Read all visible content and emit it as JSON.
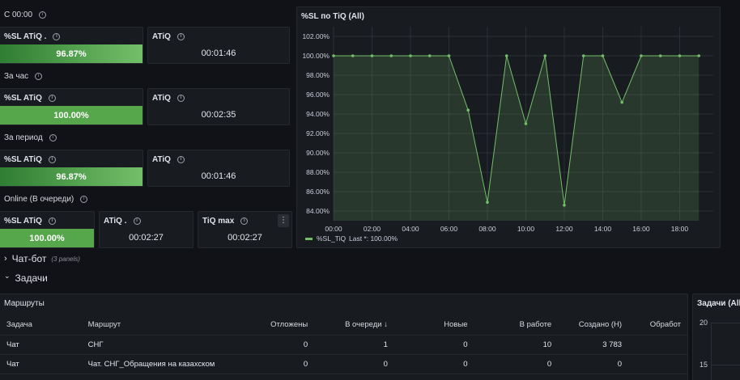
{
  "rows": {
    "c0000": "С 00:00",
    "hour": "За час",
    "period": "За период",
    "online": "Online (В очереди)"
  },
  "panels": {
    "c_sl": {
      "title": "%SL ATiQ .",
      "value": "96.87%"
    },
    "c_atiq": {
      "title": "ATiQ",
      "value": "00:01:46"
    },
    "h_sl": {
      "title": "%SL ATiQ",
      "value": "100.00%"
    },
    "h_atiq": {
      "title": "ATiQ",
      "value": "00:02:35"
    },
    "p_sl": {
      "title": "%SL ATiQ",
      "value": "96.87%"
    },
    "p_atiq": {
      "title": "ATiQ",
      "value": "00:01:46"
    },
    "o_sl": {
      "title": "%SL ATiQ",
      "value": "100.00%"
    },
    "o_atiq": {
      "title": "ATiQ .",
      "value": "00:02:27"
    },
    "o_tiq": {
      "title": "TiQ max",
      "value": "00:02:27",
      "menu": "⋮"
    }
  },
  "sections": {
    "chatbot": {
      "arrow": "›",
      "label": "Чат-бот",
      "note": "(3 panels)"
    },
    "tasks": {
      "arrow": "⌄",
      "label": "Задачи"
    }
  },
  "routes": {
    "title": "Маршруты",
    "columns": [
      "Задача",
      "Маршрут",
      "Отложены",
      "В очереди ↓",
      "Новые",
      "В работе",
      "Создано (Н)",
      "Обработ"
    ],
    "rows": [
      [
        "Чат",
        "СНГ",
        "0",
        "1",
        "0",
        "10",
        "3 783",
        ""
      ],
      [
        "Чат",
        "Чат. СНГ_Обращения на казахском",
        "0",
        "0",
        "0",
        "0",
        "0",
        ""
      ]
    ]
  },
  "tasks_panel": {
    "title": "Задачи (All",
    "ticks": [
      "20",
      "15"
    ]
  },
  "chart_data": {
    "type": "line",
    "title": "%SL по TiQ (All)",
    "series": [
      {
        "name": "%SL_TiQ",
        "color": "#73bf69",
        "x": [
          "00:00",
          "01:00",
          "02:00",
          "03:00",
          "04:00",
          "05:00",
          "06:00",
          "07:00",
          "08:00",
          "09:00",
          "10:00",
          "11:00",
          "12:00",
          "13:00",
          "14:00",
          "15:00",
          "16:00",
          "17:00",
          "18:00",
          "19:00"
        ],
        "values": [
          100,
          100,
          100,
          100,
          100,
          100,
          100,
          94.4,
          84.9,
          100,
          93,
          100,
          84.6,
          100,
          100,
          95.2,
          100,
          100,
          100,
          100
        ]
      }
    ],
    "x_ticks": [
      "00:00",
      "02:00",
      "04:00",
      "06:00",
      "08:00",
      "10:00",
      "12:00",
      "14:00",
      "16:00",
      "18:00"
    ],
    "y_ticks": [
      "84.00%",
      "86.00%",
      "88.00%",
      "90.00%",
      "92.00%",
      "94.00%",
      "96.00%",
      "98.00%",
      "100.00%",
      "102.00%"
    ],
    "ylim": [
      83,
      103
    ],
    "xlim": [
      0,
      19.75
    ],
    "grid": true,
    "legend": {
      "placement": "bottom-left",
      "label": "%SL_TiQ",
      "last": "Last *: 100.00%"
    }
  }
}
